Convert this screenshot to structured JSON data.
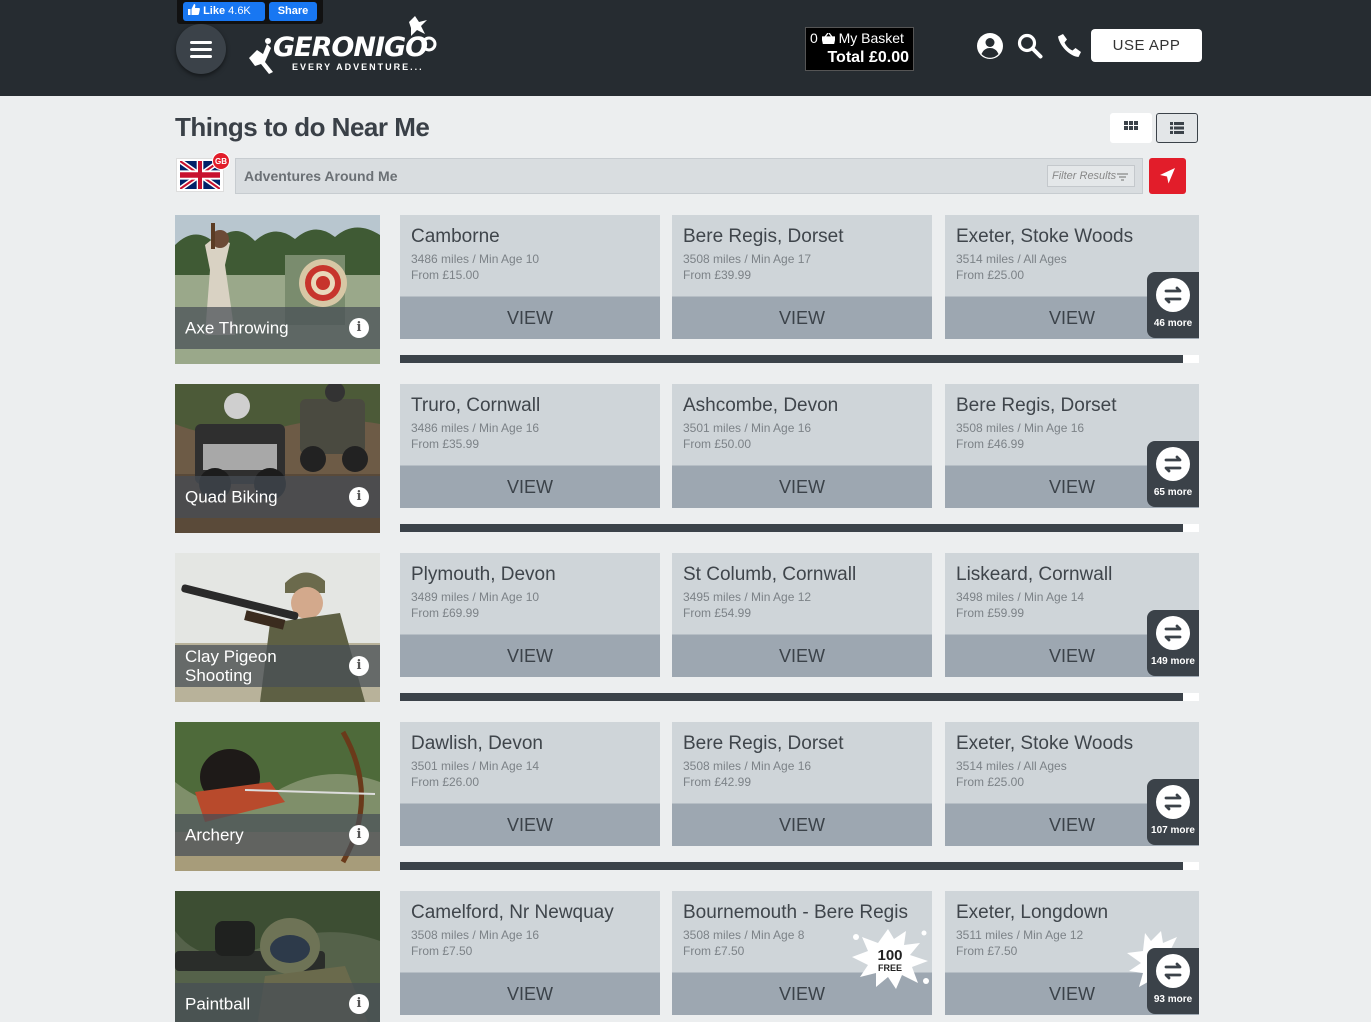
{
  "header": {
    "fb_like": "Like",
    "fb_like_count": "4.6K",
    "fb_share": "Share",
    "logo_text": "GERONIGO",
    "logo_tagline": "EVERY ADVENTURE...",
    "basket_count": "0",
    "basket_label": "My Basket",
    "basket_total_label": "Total",
    "basket_total": "£0.00",
    "use_app": "USE APP"
  },
  "page": {
    "title": "Things to do Near Me",
    "country_badge": "GB",
    "search_placeholder": "Adventures Around Me",
    "filter_label": "Filter Results"
  },
  "rows": [
    {
      "activity": "Axe Throwing",
      "more": "46 more",
      "cards": [
        {
          "location": "Camborne",
          "meta": "3486 miles / Min Age 10",
          "price": "From £15.00",
          "view": "VIEW"
        },
        {
          "location": "Bere Regis, Dorset",
          "meta": "3508 miles / Min Age 17",
          "price": "From £39.99",
          "view": "VIEW"
        },
        {
          "location": "Exeter, Stoke Woods",
          "meta": "3514 miles / All Ages",
          "price": "From £25.00",
          "view": "VIEW"
        }
      ]
    },
    {
      "activity": "Quad Biking",
      "more": "65 more",
      "cards": [
        {
          "location": "Truro, Cornwall",
          "meta": "3486 miles / Min Age 16",
          "price": "From £35.99",
          "view": "VIEW"
        },
        {
          "location": "Ashcombe, Devon",
          "meta": "3501 miles / Min Age 16",
          "price": "From £50.00",
          "view": "VIEW"
        },
        {
          "location": "Bere Regis, Dorset",
          "meta": "3508 miles / Min Age 16",
          "price": "From £46.99",
          "view": "VIEW"
        }
      ]
    },
    {
      "activity": "Clay Pigeon Shooting",
      "more": "149 more",
      "cards": [
        {
          "location": "Plymouth, Devon",
          "meta": "3489 miles / Min Age 10",
          "price": "From £69.99",
          "view": "VIEW"
        },
        {
          "location": "St Columb, Cornwall",
          "meta": "3495 miles / Min Age 12",
          "price": "From £54.99",
          "view": "VIEW"
        },
        {
          "location": "Liskeard, Cornwall",
          "meta": "3498 miles / Min Age 14",
          "price": "From £59.99",
          "view": "VIEW"
        }
      ]
    },
    {
      "activity": "Archery",
      "more": "107 more",
      "cards": [
        {
          "location": "Dawlish, Devon",
          "meta": "3501 miles / Min Age 14",
          "price": "From £26.00",
          "view": "VIEW"
        },
        {
          "location": "Bere Regis, Dorset",
          "meta": "3508 miles / Min Age 16",
          "price": "From £42.99",
          "view": "VIEW"
        },
        {
          "location": "Exeter, Stoke Woods",
          "meta": "3514 miles / All Ages",
          "price": "From £25.00",
          "view": "VIEW"
        }
      ]
    },
    {
      "activity": "Paintball",
      "more": "93 more",
      "cards": [
        {
          "location": "Camelford, Nr Newquay",
          "meta": "3508 miles / Min Age 16",
          "price": "From £7.50",
          "view": "VIEW"
        },
        {
          "location": "Bournemouth - Bere Regis",
          "meta": "3508 miles / Min Age 8",
          "price": "From £7.50",
          "view": "VIEW",
          "badge_num": "100",
          "badge_word": "FREE"
        },
        {
          "location": "Exeter, Longdown",
          "meta": "3511 miles / Min Age 12",
          "price": "From £7.50",
          "view": "VIEW"
        }
      ]
    }
  ],
  "colors": {
    "header_bg": "#262c31",
    "accent_red": "#e21d2a",
    "card_bg": "#cfd5d9",
    "view_bg": "#9da7b1",
    "facebook_blue": "#1877f2"
  },
  "icons": [
    "menu-icon",
    "user-icon",
    "search-icon",
    "phone-icon",
    "basket-icon",
    "grid-view-icon",
    "list-view-icon",
    "filter-icon",
    "locate-arrow-icon",
    "info-icon",
    "swap-arrows-icon",
    "thumbs-up-icon"
  ]
}
